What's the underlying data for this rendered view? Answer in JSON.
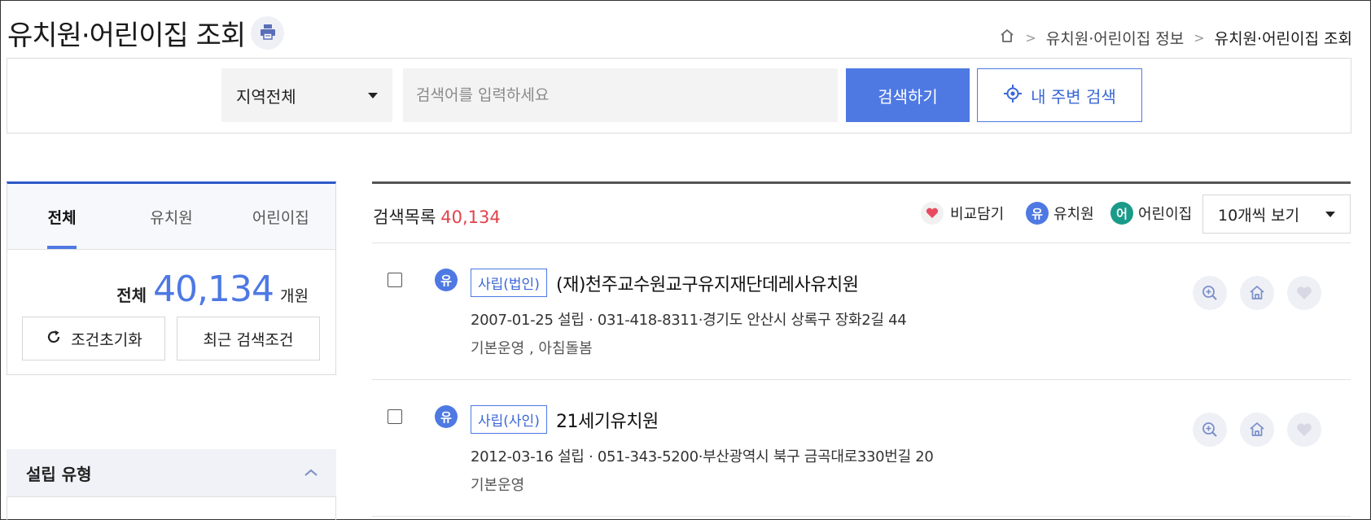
{
  "header": {
    "title": "유치원·어린이집 조회",
    "print_icon": "printer-icon",
    "breadcrumb": [
      {
        "label": "유치원·어린이집 정보"
      },
      {
        "label": "유치원·어린이집 조회"
      }
    ]
  },
  "search": {
    "region_label": "지역전체",
    "placeholder": "검색어를 입력하세요",
    "search_button": "검색하기",
    "nearby_button": "내 주변 검색"
  },
  "sidebar": {
    "tabs": [
      {
        "label": "전체",
        "active": true
      },
      {
        "label": "유치원",
        "active": false
      },
      {
        "label": "어린이집",
        "active": false
      }
    ],
    "total_label": "전체",
    "total_value": "40,134",
    "total_unit": "개원",
    "reset_button": "조건초기화",
    "recent_button": "최근 검색조건",
    "filter_title": "설립 유형"
  },
  "results": {
    "count_label": "검색목록",
    "count_value": "40,134",
    "legend": {
      "compare": "비교담기",
      "kindergarten_badge": "유",
      "kindergarten": "유치원",
      "daycare_badge": "어",
      "daycare": "어린이집"
    },
    "view_option": "10개씩 보기",
    "items": [
      {
        "badge": "유",
        "type_tag": "사립(법인)",
        "name": "(재)천주교수원교구유지재단데레사유치원",
        "info": "2007-01-25 설립 · 031-418-8311·경기도 안산시 상록구 장화2길 44",
        "service": "기본운영 , 아침돌봄"
      },
      {
        "badge": "유",
        "type_tag": "사립(사인)",
        "name": "21세기유치원",
        "info": "2012-03-16 설립 · 051-343-5200·부산광역시 북구 금곡대로330번길 20",
        "service": "기본운영"
      }
    ]
  },
  "colors": {
    "accent": "#4e79e3",
    "accent_dark": "#2e58c8",
    "count_red": "#e0434b",
    "daycare_teal": "#1a9b89",
    "heart_red": "#e84a5f"
  }
}
